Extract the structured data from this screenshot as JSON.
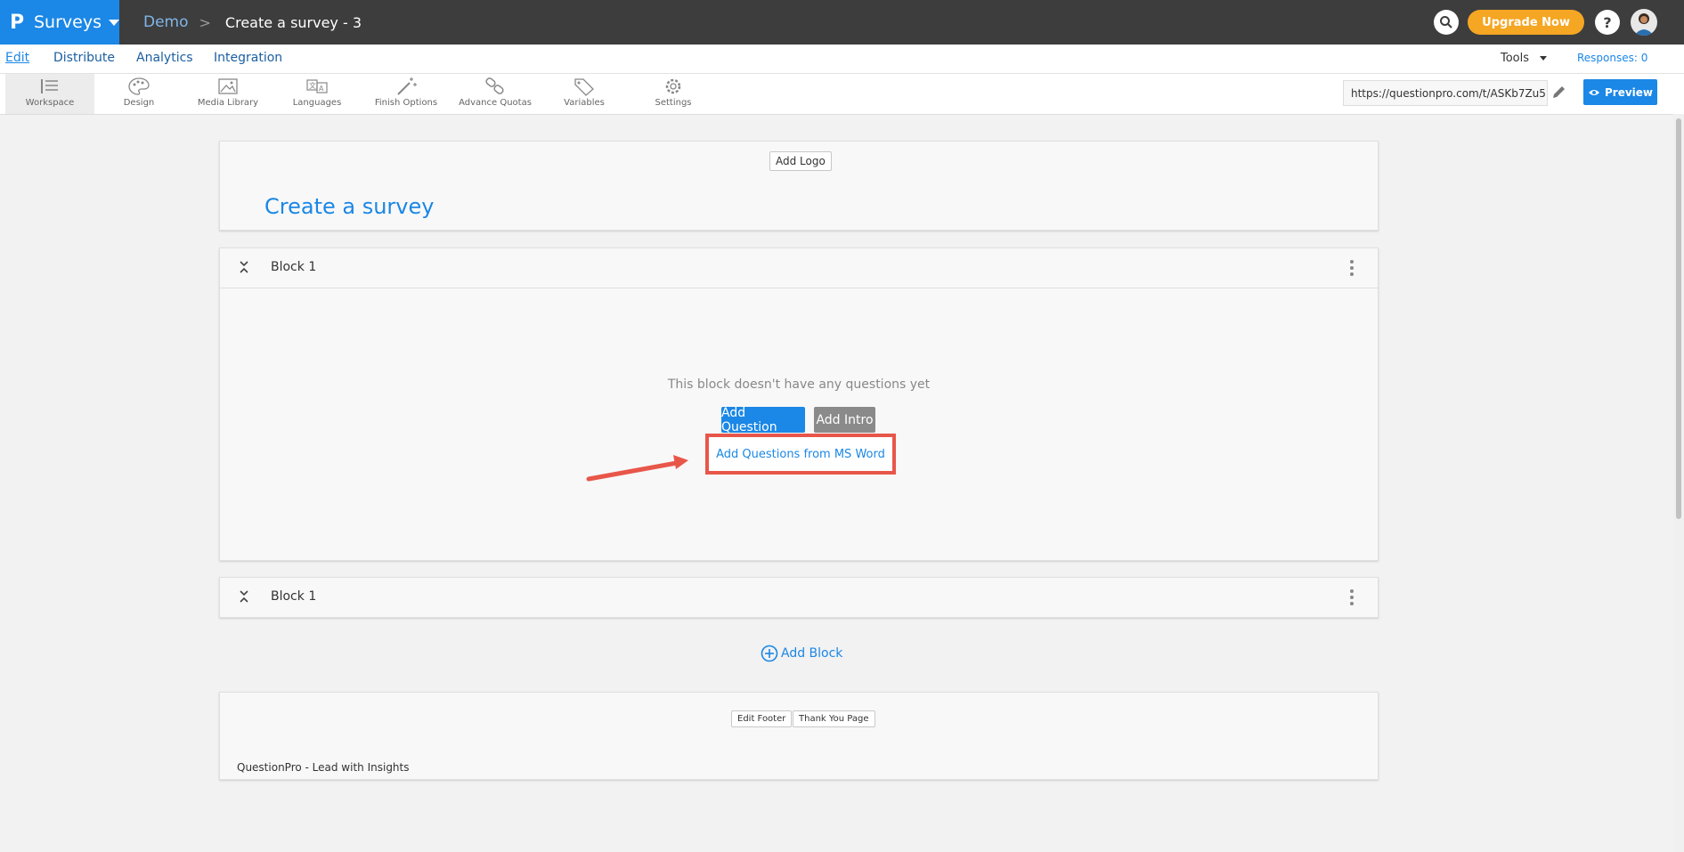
{
  "topbar": {
    "logo": "P",
    "product": "Surveys",
    "breadcrumb_home": "Demo",
    "breadcrumb_sep": ">",
    "survey_title": "Create a survey - 3",
    "upgrade_label": "Upgrade Now",
    "help_label": "?"
  },
  "nav": {
    "tabs": [
      {
        "label": "Edit",
        "active": true
      },
      {
        "label": "Distribute"
      },
      {
        "label": "Analytics"
      },
      {
        "label": "Integration"
      }
    ],
    "tools_label": "Tools",
    "responses_label": "Responses: 0"
  },
  "toolbar": {
    "items": [
      {
        "label": "Workspace",
        "icon": "workspace-icon"
      },
      {
        "label": "Design",
        "icon": "palette-icon"
      },
      {
        "label": "Media Library",
        "icon": "image-icon"
      },
      {
        "label": "Languages",
        "icon": "languages-icon"
      },
      {
        "label": "Finish Options",
        "icon": "magic-wand-icon"
      },
      {
        "label": "Advance Quotas",
        "icon": "link-icon"
      },
      {
        "label": "Variables",
        "icon": "tag-icon"
      },
      {
        "label": "Settings",
        "icon": "gear-icon"
      }
    ],
    "survey_url": "https://questionpro.com/t/ASKb7Zu5",
    "preview_label": "Preview"
  },
  "header_card": {
    "add_logo_label": "Add Logo",
    "title": "Create a survey"
  },
  "blocks": [
    {
      "name": "Block 1",
      "empty_text": "This block doesn't have any questions yet",
      "add_question_label": "Add Question",
      "add_intro_label": "Add Intro",
      "ms_word_label": "Add Questions from MS Word"
    },
    {
      "name": "Block 1"
    }
  ],
  "add_block_label": "Add Block",
  "footer": {
    "edit_footer_label": "Edit Footer",
    "thank_you_label": "Thank You Page",
    "text": "QuestionPro - Lead with Insights"
  },
  "colors": {
    "brand_blue": "#1b87e6",
    "topbar": "#3d3d3d",
    "upgrade": "#f5a623",
    "highlight": "#e8564a"
  }
}
